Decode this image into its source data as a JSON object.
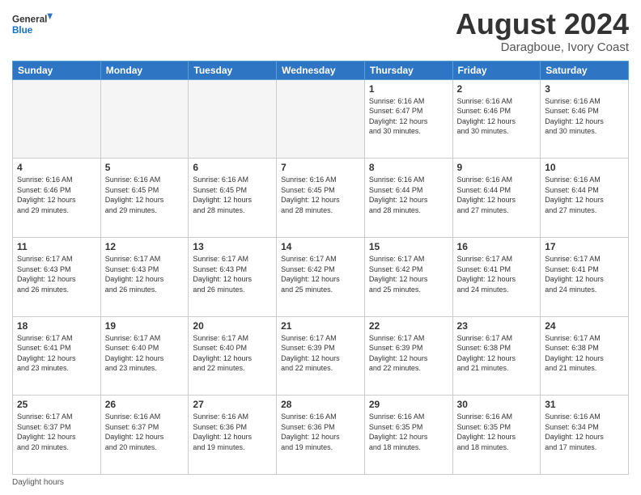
{
  "header": {
    "logo_line1": "General",
    "logo_line2": "Blue",
    "month_year": "August 2024",
    "location": "Daragboue, Ivory Coast"
  },
  "days_of_week": [
    "Sunday",
    "Monday",
    "Tuesday",
    "Wednesday",
    "Thursday",
    "Friday",
    "Saturday"
  ],
  "weeks": [
    [
      {
        "day": "",
        "info": ""
      },
      {
        "day": "",
        "info": ""
      },
      {
        "day": "",
        "info": ""
      },
      {
        "day": "",
        "info": ""
      },
      {
        "day": "1",
        "info": "Sunrise: 6:16 AM\nSunset: 6:47 PM\nDaylight: 12 hours\nand 30 minutes."
      },
      {
        "day": "2",
        "info": "Sunrise: 6:16 AM\nSunset: 6:46 PM\nDaylight: 12 hours\nand 30 minutes."
      },
      {
        "day": "3",
        "info": "Sunrise: 6:16 AM\nSunset: 6:46 PM\nDaylight: 12 hours\nand 30 minutes."
      }
    ],
    [
      {
        "day": "4",
        "info": "Sunrise: 6:16 AM\nSunset: 6:46 PM\nDaylight: 12 hours\nand 29 minutes."
      },
      {
        "day": "5",
        "info": "Sunrise: 6:16 AM\nSunset: 6:45 PM\nDaylight: 12 hours\nand 29 minutes."
      },
      {
        "day": "6",
        "info": "Sunrise: 6:16 AM\nSunset: 6:45 PM\nDaylight: 12 hours\nand 28 minutes."
      },
      {
        "day": "7",
        "info": "Sunrise: 6:16 AM\nSunset: 6:45 PM\nDaylight: 12 hours\nand 28 minutes."
      },
      {
        "day": "8",
        "info": "Sunrise: 6:16 AM\nSunset: 6:44 PM\nDaylight: 12 hours\nand 28 minutes."
      },
      {
        "day": "9",
        "info": "Sunrise: 6:16 AM\nSunset: 6:44 PM\nDaylight: 12 hours\nand 27 minutes."
      },
      {
        "day": "10",
        "info": "Sunrise: 6:16 AM\nSunset: 6:44 PM\nDaylight: 12 hours\nand 27 minutes."
      }
    ],
    [
      {
        "day": "11",
        "info": "Sunrise: 6:17 AM\nSunset: 6:43 PM\nDaylight: 12 hours\nand 26 minutes."
      },
      {
        "day": "12",
        "info": "Sunrise: 6:17 AM\nSunset: 6:43 PM\nDaylight: 12 hours\nand 26 minutes."
      },
      {
        "day": "13",
        "info": "Sunrise: 6:17 AM\nSunset: 6:43 PM\nDaylight: 12 hours\nand 26 minutes."
      },
      {
        "day": "14",
        "info": "Sunrise: 6:17 AM\nSunset: 6:42 PM\nDaylight: 12 hours\nand 25 minutes."
      },
      {
        "day": "15",
        "info": "Sunrise: 6:17 AM\nSunset: 6:42 PM\nDaylight: 12 hours\nand 25 minutes."
      },
      {
        "day": "16",
        "info": "Sunrise: 6:17 AM\nSunset: 6:41 PM\nDaylight: 12 hours\nand 24 minutes."
      },
      {
        "day": "17",
        "info": "Sunrise: 6:17 AM\nSunset: 6:41 PM\nDaylight: 12 hours\nand 24 minutes."
      }
    ],
    [
      {
        "day": "18",
        "info": "Sunrise: 6:17 AM\nSunset: 6:41 PM\nDaylight: 12 hours\nand 23 minutes."
      },
      {
        "day": "19",
        "info": "Sunrise: 6:17 AM\nSunset: 6:40 PM\nDaylight: 12 hours\nand 23 minutes."
      },
      {
        "day": "20",
        "info": "Sunrise: 6:17 AM\nSunset: 6:40 PM\nDaylight: 12 hours\nand 22 minutes."
      },
      {
        "day": "21",
        "info": "Sunrise: 6:17 AM\nSunset: 6:39 PM\nDaylight: 12 hours\nand 22 minutes."
      },
      {
        "day": "22",
        "info": "Sunrise: 6:17 AM\nSunset: 6:39 PM\nDaylight: 12 hours\nand 22 minutes."
      },
      {
        "day": "23",
        "info": "Sunrise: 6:17 AM\nSunset: 6:38 PM\nDaylight: 12 hours\nand 21 minutes."
      },
      {
        "day": "24",
        "info": "Sunrise: 6:17 AM\nSunset: 6:38 PM\nDaylight: 12 hours\nand 21 minutes."
      }
    ],
    [
      {
        "day": "25",
        "info": "Sunrise: 6:17 AM\nSunset: 6:37 PM\nDaylight: 12 hours\nand 20 minutes."
      },
      {
        "day": "26",
        "info": "Sunrise: 6:16 AM\nSunset: 6:37 PM\nDaylight: 12 hours\nand 20 minutes."
      },
      {
        "day": "27",
        "info": "Sunrise: 6:16 AM\nSunset: 6:36 PM\nDaylight: 12 hours\nand 19 minutes."
      },
      {
        "day": "28",
        "info": "Sunrise: 6:16 AM\nSunset: 6:36 PM\nDaylight: 12 hours\nand 19 minutes."
      },
      {
        "day": "29",
        "info": "Sunrise: 6:16 AM\nSunset: 6:35 PM\nDaylight: 12 hours\nand 18 minutes."
      },
      {
        "day": "30",
        "info": "Sunrise: 6:16 AM\nSunset: 6:35 PM\nDaylight: 12 hours\nand 18 minutes."
      },
      {
        "day": "31",
        "info": "Sunrise: 6:16 AM\nSunset: 6:34 PM\nDaylight: 12 hours\nand 17 minutes."
      }
    ]
  ],
  "footer": {
    "note": "Daylight hours"
  }
}
